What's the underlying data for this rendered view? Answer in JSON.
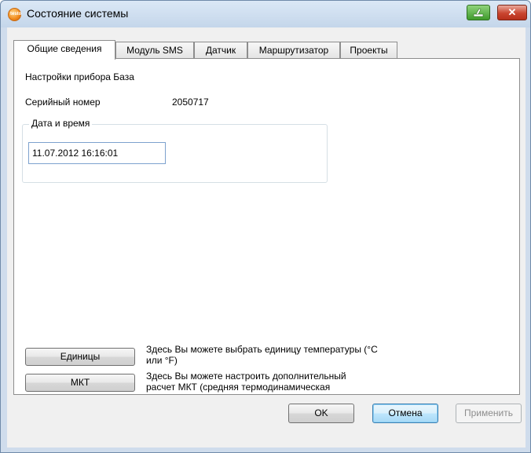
{
  "window": {
    "title": "Состояние системы",
    "app_icon_text": "testo"
  },
  "tabs": [
    {
      "label": "Общие сведения",
      "active": true
    },
    {
      "label": "Модуль SMS",
      "active": false
    },
    {
      "label": "Датчик",
      "active": false
    },
    {
      "label": "Маршрутизатор",
      "active": false
    },
    {
      "label": "Проекты",
      "active": false
    }
  ],
  "general": {
    "device_settings_label": "Настройки прибора База",
    "serial_label": "Серийный номер",
    "serial_value": "2050717",
    "datetime_group_title": "Дата и время",
    "datetime_value": "11.07.2012 16:16:01"
  },
  "actions": {
    "units_button": "Единицы",
    "units_desc_line1": "Здесь Вы можете выбрать единицу температуры (°C",
    "units_desc_line2": "или °F)",
    "mkt_button": "МКТ",
    "mkt_desc_line1": "Здесь Вы можете настроить дополнительный",
    "mkt_desc_line2": "расчет МКТ (средняя термодинамическая"
  },
  "footer": {
    "ok": "OK",
    "cancel": "Отмена",
    "apply": "Применить"
  },
  "colors": {
    "frame": "#cfdcec",
    "close_button": "#c9452f",
    "restore_button": "#3f9b2c",
    "focus_border": "#3c7fb1"
  }
}
